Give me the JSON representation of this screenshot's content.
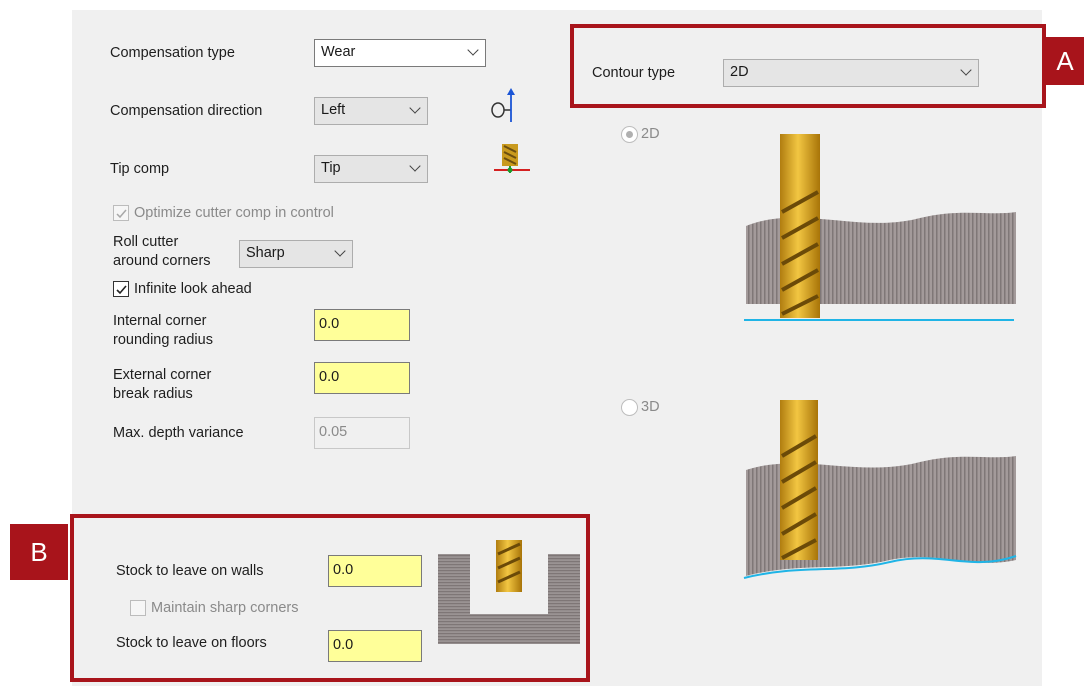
{
  "compensation": {
    "type_label": "Compensation type",
    "type_value": "Wear",
    "direction_label": "Compensation direction",
    "direction_value": "Left",
    "tip_label": "Tip comp",
    "tip_value": "Tip",
    "optimize_label": "Optimize cutter comp in control",
    "optimize_checked": true,
    "roll_label_line1": "Roll cutter",
    "roll_label_line2": "around corners",
    "roll_value": "Sharp",
    "infinite_label": "Infinite look ahead",
    "infinite_checked": true,
    "internal_label_line1": "Internal corner",
    "internal_label_line2": "rounding radius",
    "internal_value": "0.0",
    "external_label_line1": "External corner",
    "external_label_line2": "break radius",
    "external_value": "0.0",
    "max_depth_label": "Max. depth variance",
    "max_depth_value": "0.05"
  },
  "contour": {
    "type_label": "Contour type",
    "type_value": "2D",
    "option_2d": "2D",
    "option_3d": "3D",
    "selected": "2D"
  },
  "stock": {
    "walls_label": "Stock to leave on walls",
    "walls_value": "0.0",
    "sharp_label": "Maintain sharp corners",
    "sharp_checked": false,
    "floors_label": "Stock to leave on floors",
    "floors_value": "0.0"
  },
  "annotations": {
    "a": "A",
    "b": "B"
  },
  "colors": {
    "highlight_red": "#a8141b",
    "input_yellow": "#ffff99",
    "tool_gold": "#d4a017",
    "floor_line": "#1fb4e6"
  }
}
